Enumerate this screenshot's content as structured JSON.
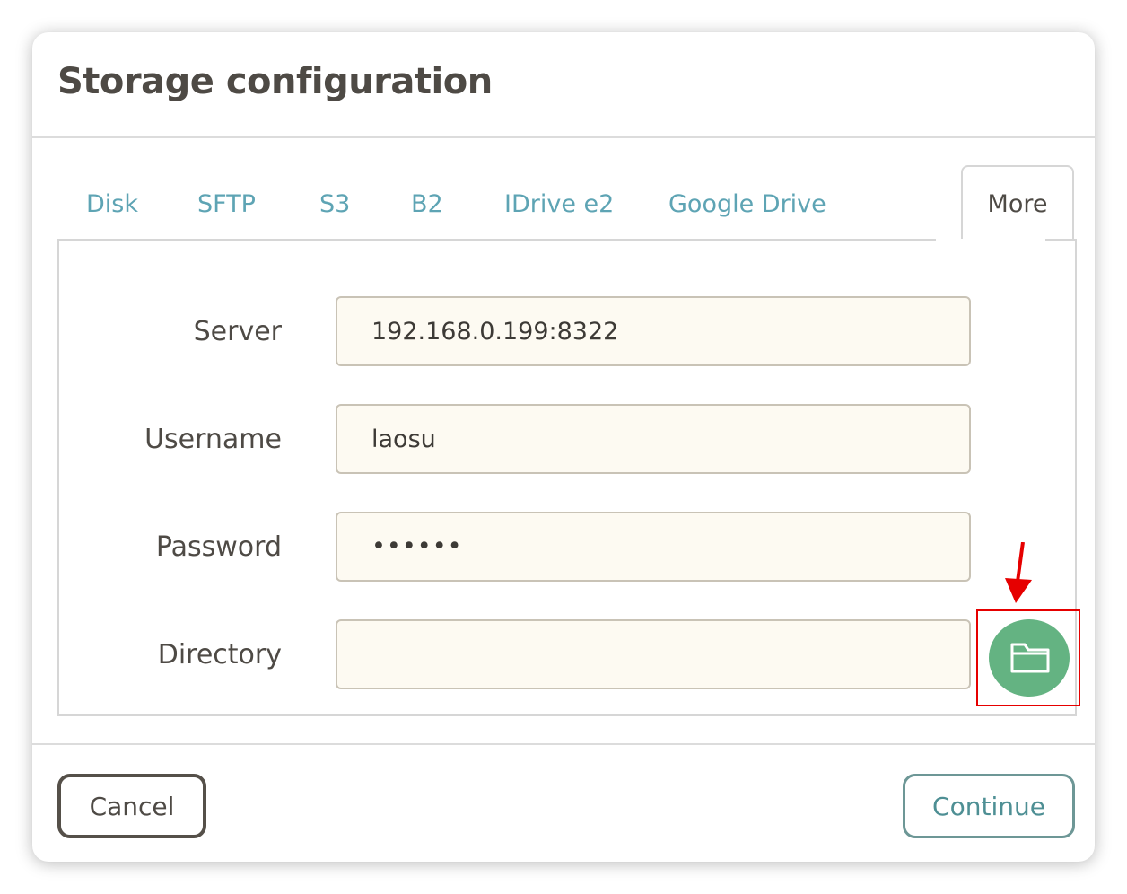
{
  "dialog": {
    "title": "Storage configuration"
  },
  "tabs": {
    "items": [
      "Disk",
      "SFTP",
      "S3",
      "B2",
      "IDrive e2",
      "Google Drive"
    ],
    "active": "More"
  },
  "form": {
    "server": {
      "label": "Server",
      "value": "192.168.0.199:8322"
    },
    "username": {
      "label": "Username",
      "value": "laosu"
    },
    "password": {
      "label": "Password",
      "value": "••••••"
    },
    "directory": {
      "label": "Directory",
      "value": ""
    }
  },
  "icons": {
    "browse": "folder-icon",
    "annotation": "red-arrow-icon"
  },
  "colors": {
    "accent_tab": "#5ea4b4",
    "browse_button": "#64b382",
    "field_bg": "#fdfaf2",
    "highlight": "#e60000"
  },
  "footer": {
    "cancel_label": "Cancel",
    "continue_label": "Continue"
  }
}
